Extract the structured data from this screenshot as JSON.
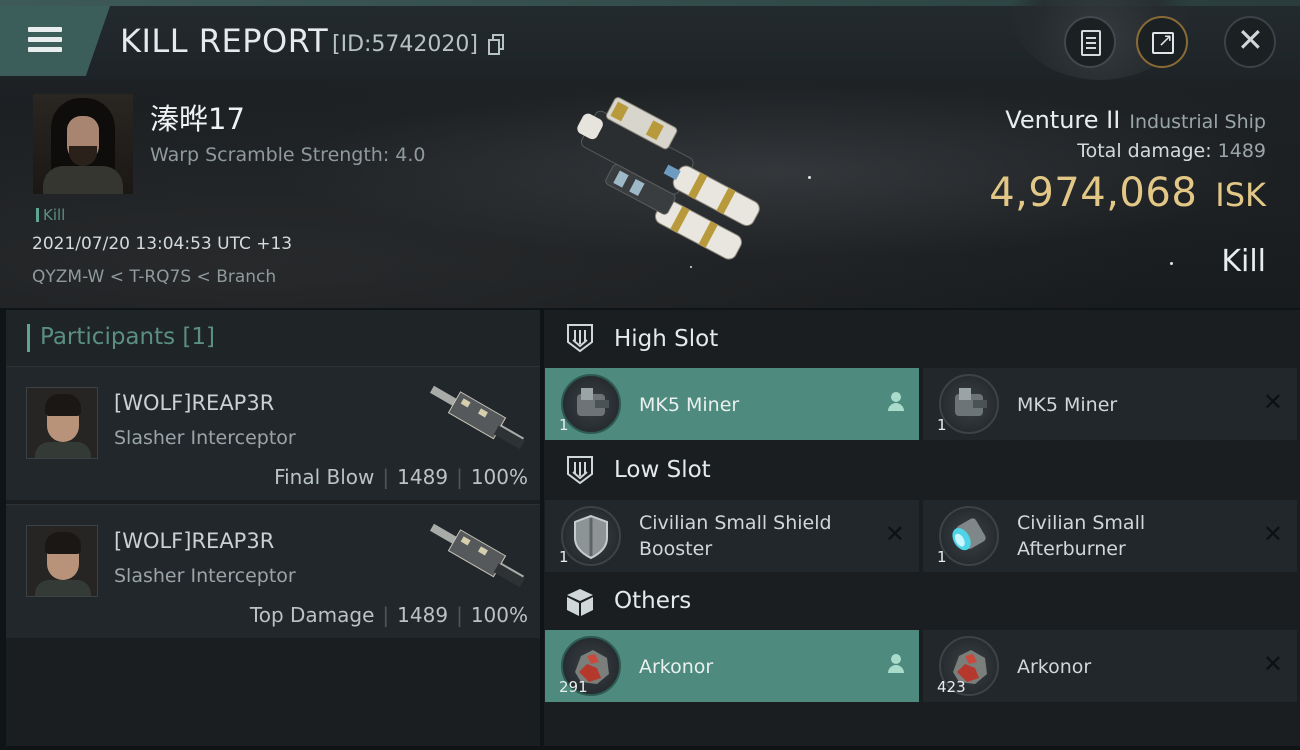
{
  "header": {
    "title": "KILL REPORT",
    "report_id": "[ID:5742020]"
  },
  "victim": {
    "name": "溱晔17",
    "warp_scramble": "Warp Scramble Strength: 4.0",
    "kill_tag": "Kill",
    "timestamp": "2021/07/20 13:04:53 UTC +13",
    "location": "QYZM-W < T-RQ7S < Branch",
    "ship_name": "Venture II",
    "ship_class": "Industrial Ship",
    "damage_label": "Total damage:",
    "damage_value": "1489",
    "isk_value": "4,974,068",
    "isk_unit": "ISK",
    "result": "Kill"
  },
  "participants": {
    "title": "Participants [1]",
    "list": [
      {
        "name": "[WOLF]REAP3R",
        "ship": "Slasher Interceptor",
        "role": "Final Blow",
        "damage": "1489",
        "percent": "100%"
      },
      {
        "name": "[WOLF]REAP3R",
        "ship": "Slasher Interceptor",
        "role": "Top Damage",
        "damage": "1489",
        "percent": "100%"
      }
    ]
  },
  "slots": {
    "high": {
      "title": "High Slot",
      "items": [
        {
          "qty": "1",
          "name": "MK5 Miner",
          "state": "destroyed-by-owner"
        },
        {
          "qty": "1",
          "name": "MK5 Miner",
          "state": "destroyed"
        }
      ]
    },
    "low": {
      "title": "Low Slot",
      "items": [
        {
          "qty": "1",
          "name_line1": "Civilian Small Shield",
          "name_line2": "Booster"
        },
        {
          "qty": "1",
          "name_line1": "Civilian Small",
          "name_line2": "Afterburner"
        }
      ]
    },
    "others": {
      "title": "Others",
      "items": [
        {
          "qty": "291",
          "name": "Arkonor"
        },
        {
          "qty": "423",
          "name": "Arkonor"
        }
      ]
    }
  },
  "colors": {
    "accent_teal": "#4e8a7d",
    "isk_gold": "#e2c786",
    "panel_dark": "#1a1e21"
  }
}
